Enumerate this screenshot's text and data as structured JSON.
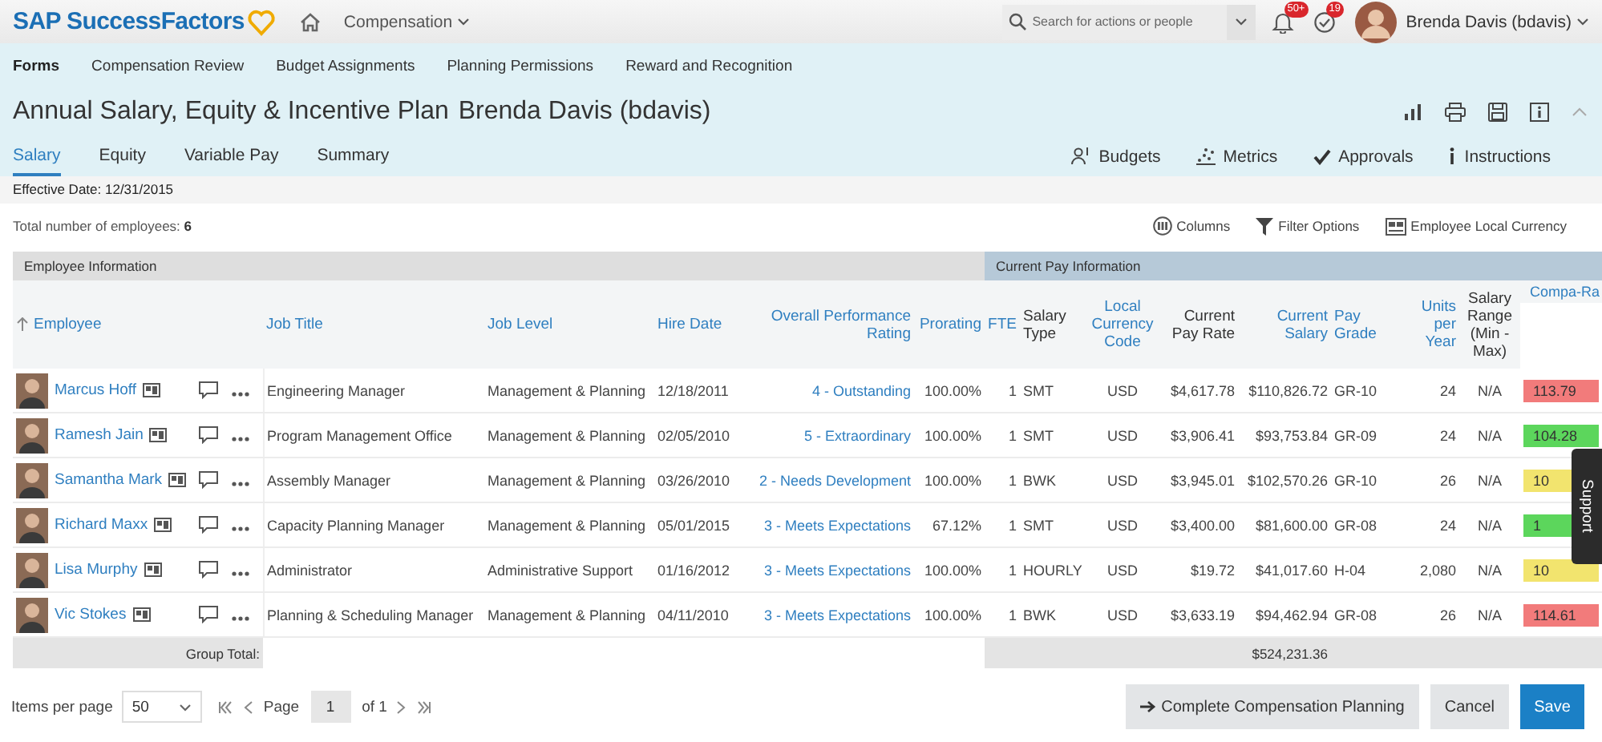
{
  "brand": {
    "name": "SAP SuccessFactors"
  },
  "topbar": {
    "module": "Compensation",
    "search": {
      "placeholder": "Search for actions or people"
    },
    "notifications": "50+",
    "todos": "19",
    "user": "Brenda Davis (bdavis)"
  },
  "nav": [
    {
      "label": "Forms",
      "selected": true
    },
    {
      "label": "Compensation Review",
      "selected": false
    },
    {
      "label": "Budget Assignments",
      "selected": false
    },
    {
      "label": "Planning Permissions",
      "selected": false
    },
    {
      "label": "Reward and Recognition",
      "selected": false
    }
  ],
  "form": {
    "title": "Annual Salary, Equity & Incentive Plan",
    "owner": "Brenda Davis (bdavis)"
  },
  "tabs": [
    {
      "label": "Salary",
      "selected": true
    },
    {
      "label": "Equity",
      "selected": false
    },
    {
      "label": "Variable Pay",
      "selected": false
    },
    {
      "label": "Summary",
      "selected": false
    }
  ],
  "actions": [
    {
      "label": "Budgets",
      "kind": "budgets"
    },
    {
      "label": "Metrics",
      "kind": "metrics"
    },
    {
      "label": "Approvals",
      "kind": "approvals"
    },
    {
      "label": "Instructions",
      "kind": "instructions"
    }
  ],
  "effective_date": "Effective Date: 12/31/2015",
  "total": "Total number of employees: **6**",
  "tools": [
    {
      "label": "Columns",
      "kind": "columns"
    },
    {
      "label": "Filter Options",
      "kind": "filter"
    },
    {
      "label": "Employee Local Currency",
      "kind": "currency"
    }
  ],
  "table": {
    "groups": [
      {
        "label": "Employee Information",
        "kind": "employee"
      },
      {
        "label": "Current Pay Information",
        "kind": "pay"
      }
    ],
    "columns": [
      {
        "label": "Employee",
        "kind": "name",
        "sortable": true,
        "sorted": true
      },
      {
        "label": "Job Title",
        "kind": "text",
        "sortable": true,
        "sorted": false
      },
      {
        "label": "Job Level",
        "kind": "text",
        "sortable": true,
        "sorted": false
      },
      {
        "label": "Hire Date",
        "kind": "text",
        "sortable": true,
        "sorted": false
      },
      {
        "label": "Overall Performance Rating",
        "kind": "rating",
        "sortable": true,
        "sorted": false
      },
      {
        "label": "Prorating",
        "kind": "number",
        "sortable": true,
        "sorted": false
      },
      {
        "label": "FTE",
        "kind": "number",
        "sortable": true,
        "sorted": false
      },
      {
        "label": "Salary Type",
        "kind": "text",
        "sortable": false,
        "sorted": false
      },
      {
        "label": "Local Currency Code",
        "kind": "center",
        "sortable": true,
        "sorted": false
      },
      {
        "label": "Current Pay Rate",
        "kind": "number",
        "sortable": false,
        "sorted": false
      },
      {
        "label": "Current Salary",
        "kind": "number",
        "sortable": true,
        "sorted": false
      },
      {
        "label": "Pay Grade",
        "kind": "text",
        "sortable": true,
        "sorted": false
      },
      {
        "label": "Units per Year",
        "kind": "number",
        "sortable": true,
        "sorted": false
      },
      {
        "label": "Salary Range (Min - Max)",
        "kind": "center",
        "sortable": false,
        "sorted": false
      },
      {
        "label": "Compa-Ra",
        "kind": "compa",
        "sortable": true,
        "sorted": false
      }
    ],
    "rows": [
      {
        "cells": [
          "Marcus Hoff",
          "Engineering Manager",
          "Management & Planning",
          "12/18/2011",
          "4 - Outstanding",
          "100.00%",
          "1",
          "SMT",
          "USD",
          "$4,617.78",
          "$110,826.72",
          "GR-10",
          "24",
          "N/A",
          "113.79"
        ],
        "color": "#f27b7b"
      },
      {
        "cells": [
          "Ramesh Jain",
          "Program Management Office",
          "Management & Planning",
          "02/05/2010",
          "5 - Extraordinary",
          "100.00%",
          "1",
          "SMT",
          "USD",
          "$3,906.41",
          "$93,753.84",
          "GR-09",
          "24",
          "N/A",
          "104.28"
        ],
        "color": "#5cd65c"
      },
      {
        "cells": [
          "Samantha Mark",
          "Assembly Manager",
          "Management & Planning",
          "03/26/2010",
          "2 - Needs Development",
          "100.00%",
          "1",
          "BWK",
          "USD",
          "$3,945.01",
          "$102,570.26",
          "GR-10",
          "26",
          "N/A",
          "10"
        ],
        "color": "#f2e46e"
      },
      {
        "cells": [
          "Richard Maxx",
          "Capacity Planning Manager",
          "Management & Planning",
          "05/01/2015",
          "3 - Meets Expectations",
          "67.12%",
          "1",
          "SMT",
          "USD",
          "$3,400.00",
          "$81,600.00",
          "GR-08",
          "24",
          "N/A",
          "1"
        ],
        "color": "#5cd65c"
      },
      {
        "cells": [
          "Lisa Murphy",
          "Administrator",
          "Administrative Support",
          "01/16/2012",
          "3 - Meets Expectations",
          "100.00%",
          "1",
          "HOURLY",
          "USD",
          "$19.72",
          "$41,017.60",
          "H-04",
          "2,080",
          "N/A",
          "10"
        ],
        "color": "#f2e46e"
      },
      {
        "cells": [
          "Vic Stokes",
          "Planning & Scheduling Manager",
          "Management & Planning",
          "04/11/2010",
          "3 - Meets Expectations",
          "100.00%",
          "1",
          "BWK",
          "USD",
          "$3,633.19",
          "$94,462.94",
          "GR-08",
          "26",
          "N/A",
          "114.61"
        ],
        "color": "#f27b7b"
      }
    ],
    "total_label": "Group Total:",
    "total_value": "$524,231.36"
  },
  "support": "Support",
  "footer": {
    "items_label": "Items per page",
    "items_value": "50",
    "page_label": "Page",
    "page_value": "1",
    "page_of": "of 1"
  },
  "buttons": [
    {
      "label": "Complete Compensation Planning",
      "kind": "complete"
    },
    {
      "label": "Cancel",
      "kind": "cancel"
    },
    {
      "label": "Save",
      "kind": "save"
    }
  ]
}
